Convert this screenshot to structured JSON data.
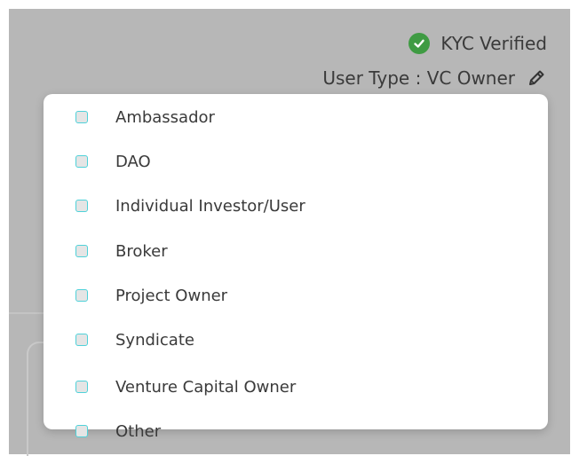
{
  "header": {
    "kyc_status": "KYC Verified",
    "user_type_label": "User Type : VC Owner",
    "verified_icon": "check-circle-icon",
    "edit_icon": "pencil-icon"
  },
  "dropdown": {
    "options": [
      {
        "label": "Ambassador",
        "checked": false
      },
      {
        "label": "DAO",
        "checked": false
      },
      {
        "label": "Individual Investor/User",
        "checked": false
      },
      {
        "label": "Broker",
        "checked": false
      },
      {
        "label": "Project Owner",
        "checked": false
      },
      {
        "label": "Syndicate",
        "checked": false
      },
      {
        "label": "Venture Capital Owner",
        "checked": false
      },
      {
        "label": "Other",
        "checked": false
      }
    ]
  },
  "colors": {
    "overlay": "#b7b7b7",
    "verified_green": "#3f9b43",
    "checkbox_border": "#4fd1d9",
    "checkbox_fill": "#e5e5e5",
    "panel": "#ffffff",
    "text": "#3a3a3a"
  }
}
